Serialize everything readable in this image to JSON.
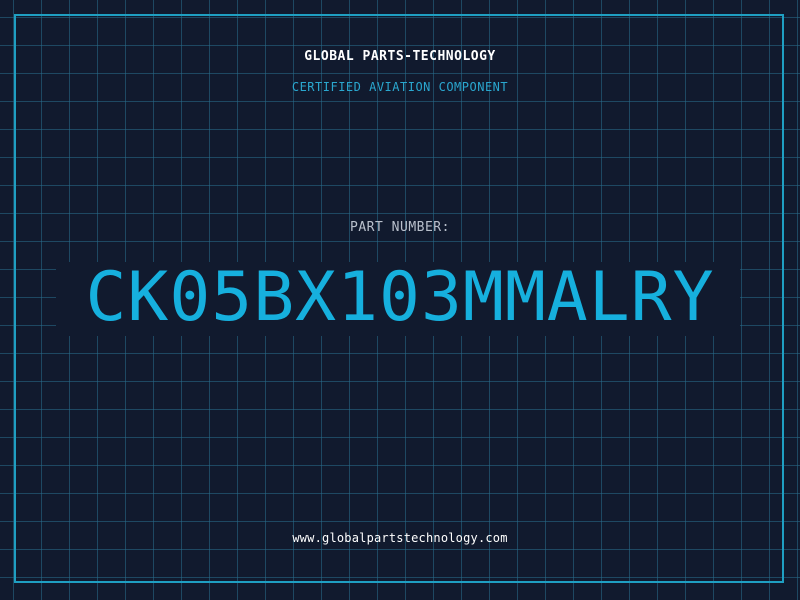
{
  "header": {
    "company": "GLOBAL PARTS-TECHNOLOGY",
    "tagline": "CERTIFIED AVIATION COMPONENT"
  },
  "part": {
    "label": "PART NUMBER:",
    "number": "CK05BX103MMALRY"
  },
  "footer": {
    "website": "www.globalpartstechnology.com"
  },
  "colors": {
    "background": "#111a2e",
    "grid": "#286e8c",
    "frame": "#1f9fc2",
    "accent": "#16b0de",
    "tagline": "#2aa7cf",
    "label": "#b9c0cc",
    "text": "#ffffff"
  }
}
